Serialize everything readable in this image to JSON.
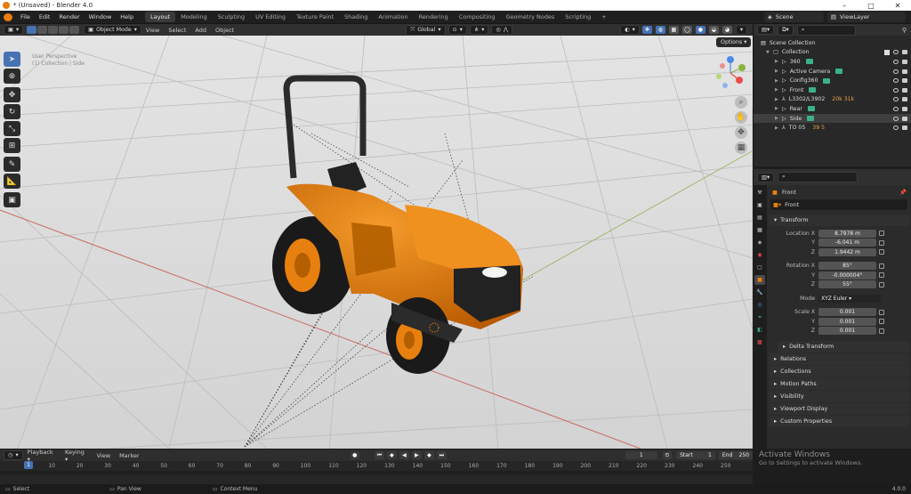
{
  "window": {
    "title": "* (Unsaved) - Blender 4.0",
    "controls": [
      "–",
      "□",
      "✕"
    ]
  },
  "menu": [
    "File",
    "Edit",
    "Render",
    "Window",
    "Help"
  ],
  "workspaces": [
    "Layout",
    "Modeling",
    "Sculpting",
    "UV Editing",
    "Texture Paint",
    "Shading",
    "Animation",
    "Rendering",
    "Compositing",
    "Geometry Nodes",
    "Scripting"
  ],
  "workspace_add": "+",
  "scene": {
    "label": "Scene",
    "view_layer": "ViewLayer"
  },
  "viewport_header": {
    "mode": "Object Mode",
    "menus": [
      "View",
      "Select",
      "Add",
      "Object"
    ],
    "orientation": "Global",
    "options": "Options"
  },
  "viewport_info": {
    "line1": "User Perspective",
    "line2": "(1) Collection | Side"
  },
  "outliner": {
    "root": "Scene Collection",
    "collection": "Collection",
    "items": [
      {
        "name": "360",
        "extra": ""
      },
      {
        "name": "Active Camera",
        "extra": ""
      },
      {
        "name": "Config360",
        "extra": ""
      },
      {
        "name": "Front",
        "extra": ""
      },
      {
        "name": "L3302/L3902",
        "extra": "20k 31k"
      },
      {
        "name": "Rear",
        "extra": ""
      },
      {
        "name": "Side",
        "extra": ""
      },
      {
        "name": "TO 05",
        "extra": "39 5"
      }
    ]
  },
  "properties": {
    "object_name": "Front",
    "data_name": "Front",
    "transform_label": "Transform",
    "location": {
      "label": "Location X",
      "x": "8.7978 m",
      "y": "-6.041 m",
      "z": "1.9442 m"
    },
    "rotation": {
      "label": "Rotation X",
      "x": "85°",
      "y": "-0.000004°",
      "z": "55°"
    },
    "mode": {
      "label": "Mode",
      "value": "XYZ Euler"
    },
    "scale": {
      "label": "Scale X",
      "x": "0.001",
      "y": "0.001",
      "z": "0.001"
    },
    "axis_y": "Y",
    "axis_z": "Z",
    "panels": [
      "Delta Transform",
      "Relations",
      "Collections",
      "Motion Paths",
      "Visibility",
      "Viewport Display",
      "Custom Properties"
    ]
  },
  "timeline": {
    "menus": [
      "Playback",
      "Keying",
      "View",
      "Marker"
    ],
    "current_frame": "1",
    "start_label": "Start",
    "start": "1",
    "end_label": "End",
    "end": "250",
    "ticks": [
      "1",
      "10",
      "20",
      "30",
      "40",
      "50",
      "60",
      "70",
      "80",
      "90",
      "100",
      "110",
      "120",
      "130",
      "140",
      "150",
      "160",
      "170",
      "180",
      "190",
      "200",
      "210",
      "220",
      "230",
      "240",
      "250"
    ]
  },
  "statusbar": {
    "select": "Select",
    "pan": "Pan View",
    "context": "Context Menu",
    "version": "4.0.0"
  },
  "watermark": {
    "line1": "Activate Windows",
    "line2": "Go to Settings to activate Windows."
  },
  "colors": {
    "accent": "#4772b3",
    "tractor": "#e87d0d",
    "object_green": "#3cb08a"
  }
}
